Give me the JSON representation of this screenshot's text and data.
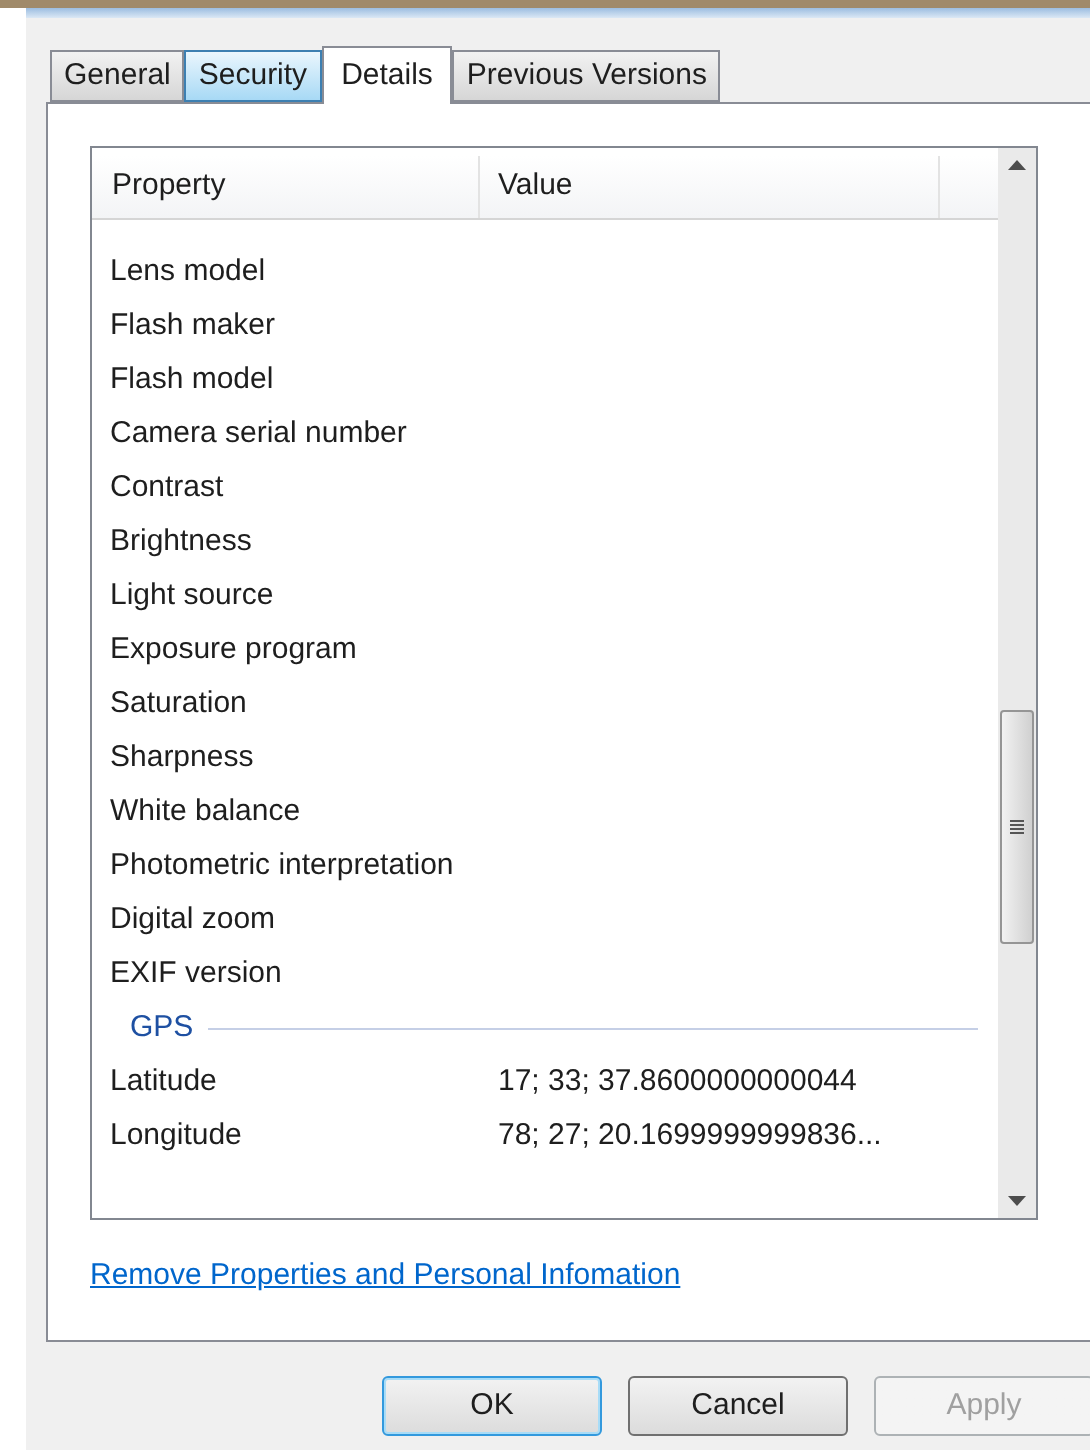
{
  "tabs": [
    {
      "label": "General",
      "selected": false,
      "hovered": false
    },
    {
      "label": "Security",
      "selected": false,
      "hovered": true
    },
    {
      "label": "Details",
      "selected": true,
      "hovered": false
    },
    {
      "label": "Previous Versions",
      "selected": false,
      "hovered": false
    }
  ],
  "details": {
    "columns": [
      "Property",
      "Value"
    ],
    "rows": [
      {
        "kind": "property",
        "property": "Lens model"
      },
      {
        "kind": "property",
        "property": "Flash maker"
      },
      {
        "kind": "property",
        "property": "Flash model"
      },
      {
        "kind": "property",
        "property": "Camera serial number"
      },
      {
        "kind": "property",
        "property": "Contrast"
      },
      {
        "kind": "property",
        "property": "Brightness"
      },
      {
        "kind": "property",
        "property": "Light source"
      },
      {
        "kind": "property",
        "property": "Exposure program"
      },
      {
        "kind": "property",
        "property": "Saturation"
      },
      {
        "kind": "property",
        "property": "Sharpness"
      },
      {
        "kind": "property",
        "property": "White balance"
      },
      {
        "kind": "property",
        "property": "Photometric interpretation"
      },
      {
        "kind": "property",
        "property": "Digital zoom"
      },
      {
        "kind": "property",
        "property": "EXIF version"
      },
      {
        "kind": "group",
        "property": "GPS"
      },
      {
        "kind": "property",
        "property": "Latitude",
        "value": "17; 33; 37.8600000000044"
      },
      {
        "kind": "property",
        "property": "Longitude",
        "value": "78; 27; 20.1699999999836..."
      }
    ]
  },
  "link": "Remove Properties and Personal Infomation",
  "buttons": [
    {
      "label": "OK",
      "default": true,
      "disabled": false
    },
    {
      "label": "Cancel",
      "default": false,
      "disabled": false
    },
    {
      "label": "Apply",
      "default": false,
      "disabled": true
    }
  ]
}
